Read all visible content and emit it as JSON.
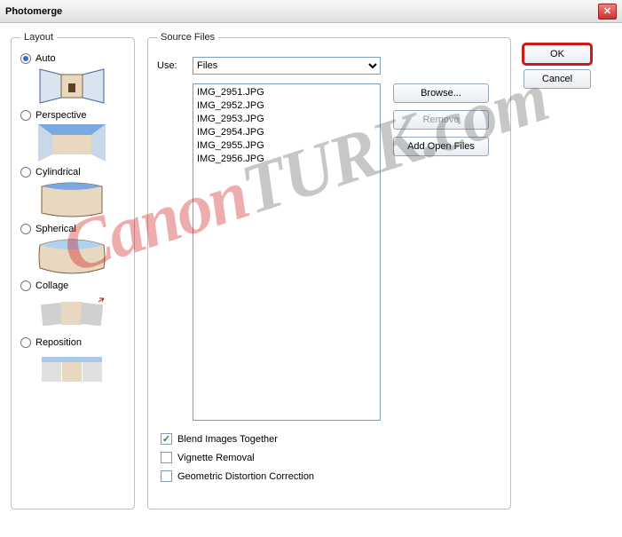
{
  "window": {
    "title": "Photomerge"
  },
  "layout": {
    "legend": "Layout",
    "options": [
      {
        "label": "Auto",
        "selected": true
      },
      {
        "label": "Perspective",
        "selected": false
      },
      {
        "label": "Cylindrical",
        "selected": false
      },
      {
        "label": "Spherical",
        "selected": false
      },
      {
        "label": "Collage",
        "selected": false
      },
      {
        "label": "Reposition",
        "selected": false
      }
    ]
  },
  "source": {
    "legend": "Source Files",
    "use_label": "Use:",
    "use_value": "Files",
    "files": [
      "IMG_2951.JPG",
      "IMG_2952.JPG",
      "IMG_2953.JPG",
      "IMG_2954.JPG",
      "IMG_2955.JPG",
      "IMG_2956.JPG"
    ],
    "browse": "Browse...",
    "remove": "Remove",
    "add_open": "Add Open Files",
    "checks": {
      "blend": {
        "label": "Blend Images Together",
        "checked": true
      },
      "vignette": {
        "label": "Vignette Removal",
        "checked": false
      },
      "geom": {
        "label": "Geometric Distortion Correction",
        "checked": false
      }
    }
  },
  "buttons": {
    "ok": "OK",
    "cancel": "Cancel"
  },
  "watermark": {
    "part1": "Canon",
    "part2": "TURK.com"
  }
}
